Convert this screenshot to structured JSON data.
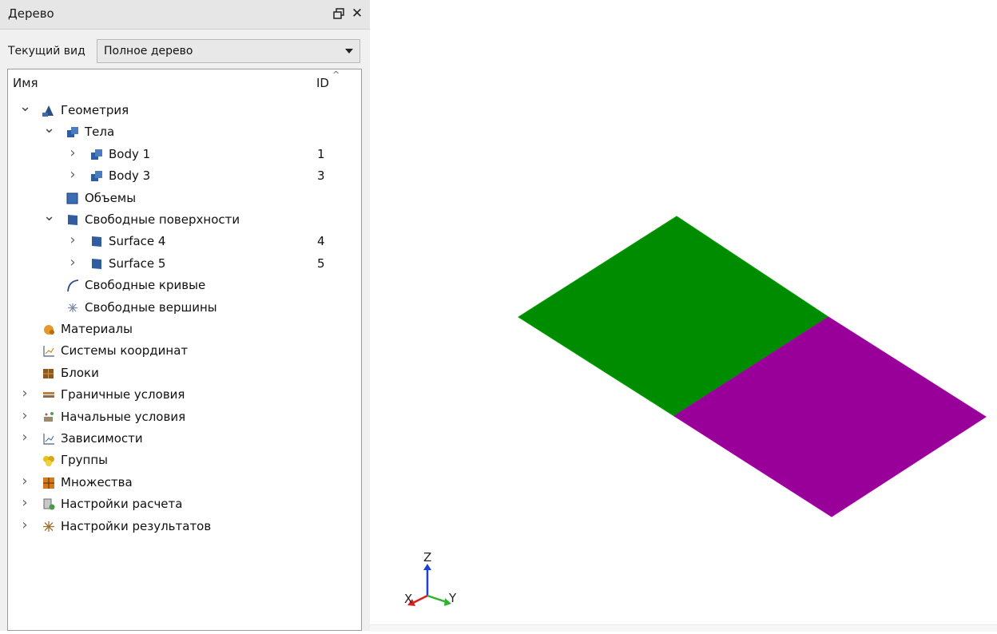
{
  "panel": {
    "title": "Дерево",
    "float_icon": "restore-icon",
    "close_icon": "close-icon",
    "view_label": "Текущий вид",
    "view_value": "Полное дерево"
  },
  "tree": {
    "col_name": "Имя",
    "col_id": "ID",
    "items": [
      {
        "label": "Геометрия",
        "id": "",
        "icon": "geometry-icon",
        "expander": "open"
      },
      {
        "label": "Тела",
        "id": "",
        "icon": "bodies-icon",
        "expander": "open"
      },
      {
        "label": "Body 1",
        "id": "1",
        "icon": "body-icon",
        "expander": "closed"
      },
      {
        "label": "Body 3",
        "id": "3",
        "icon": "body-icon",
        "expander": "closed"
      },
      {
        "label": "Объемы",
        "id": "",
        "icon": "volumes-icon",
        "expander": "none"
      },
      {
        "label": "Свободные поверхности",
        "id": "",
        "icon": "surfaces-icon",
        "expander": "open"
      },
      {
        "label": "Surface 4",
        "id": "4",
        "icon": "surface-icon",
        "expander": "closed"
      },
      {
        "label": "Surface 5",
        "id": "5",
        "icon": "surface-icon",
        "expander": "closed"
      },
      {
        "label": "Свободные кривые",
        "id": "",
        "icon": "curve-icon",
        "expander": "none"
      },
      {
        "label": "Свободные вершины",
        "id": "",
        "icon": "vertex-icon",
        "expander": "none"
      },
      {
        "label": "Материалы",
        "id": "",
        "icon": "materials-icon",
        "expander": "none"
      },
      {
        "label": "Системы координат",
        "id": "",
        "icon": "coordinate-systems-icon",
        "expander": "none"
      },
      {
        "label": "Блоки",
        "id": "",
        "icon": "blocks-icon",
        "expander": "none"
      },
      {
        "label": "Граничные условия",
        "id": "",
        "icon": "boundary-conditions-icon",
        "expander": "closed"
      },
      {
        "label": "Начальные условия",
        "id": "",
        "icon": "initial-conditions-icon",
        "expander": "closed"
      },
      {
        "label": "Зависимости",
        "id": "",
        "icon": "dependencies-icon",
        "expander": "closed"
      },
      {
        "label": "Группы",
        "id": "",
        "icon": "groups-icon",
        "expander": "none"
      },
      {
        "label": "Множества",
        "id": "",
        "icon": "sets-icon",
        "expander": "closed"
      },
      {
        "label": "Настройки расчета",
        "id": "",
        "icon": "solver-settings-icon",
        "expander": "closed"
      },
      {
        "label": "Настройки результатов",
        "id": "",
        "icon": "results-settings-icon",
        "expander": "closed"
      }
    ]
  },
  "viewport": {
    "surfaces": [
      {
        "name": "Surface 4",
        "color": "#008c00"
      },
      {
        "name": "Surface 5",
        "color": "#990099"
      }
    ],
    "axes": {
      "z_label": "Z",
      "y_label": "Y",
      "x_label": "X",
      "z_color": "#1f3fd9",
      "y_color": "#2bb52b",
      "x_color": "#d92020"
    }
  }
}
